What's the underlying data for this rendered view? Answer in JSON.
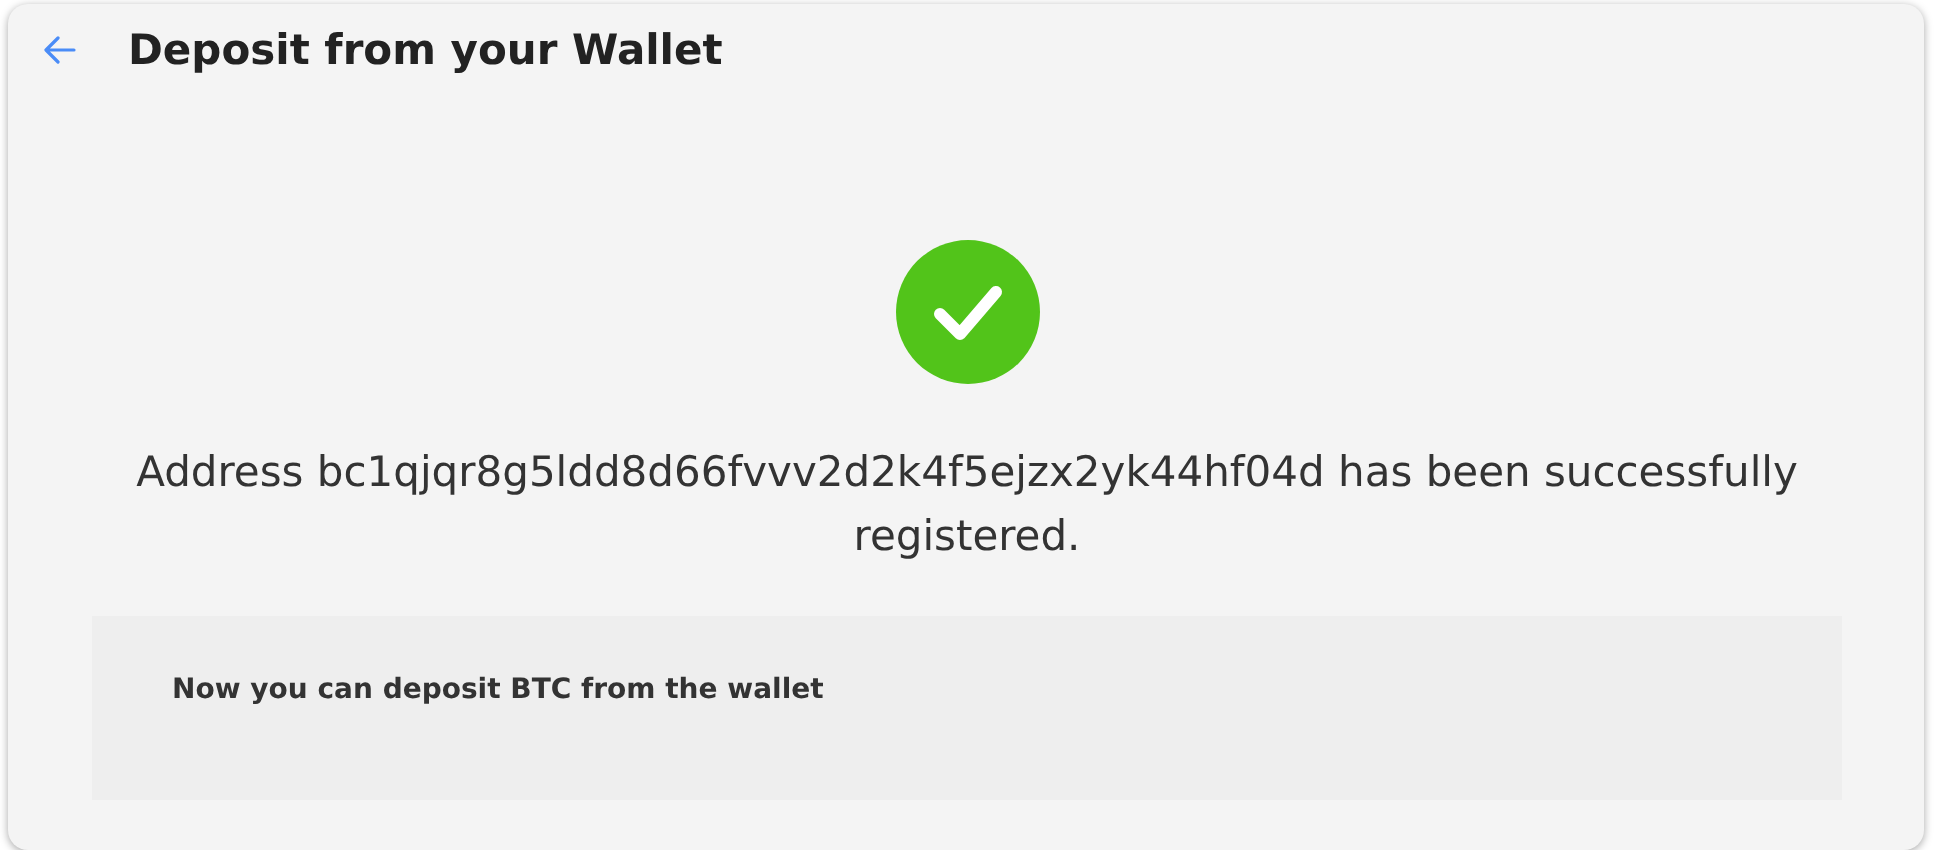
{
  "header": {
    "title": "Deposit from your Wallet"
  },
  "result": {
    "kind": "success",
    "message": "Address bc1qjqr8g5ldd8d66fvvv2d2k4f5ejzx2yk44hf04d has been successfully registered."
  },
  "note": {
    "text": "Now you can deposit BTC from the wallet"
  }
}
